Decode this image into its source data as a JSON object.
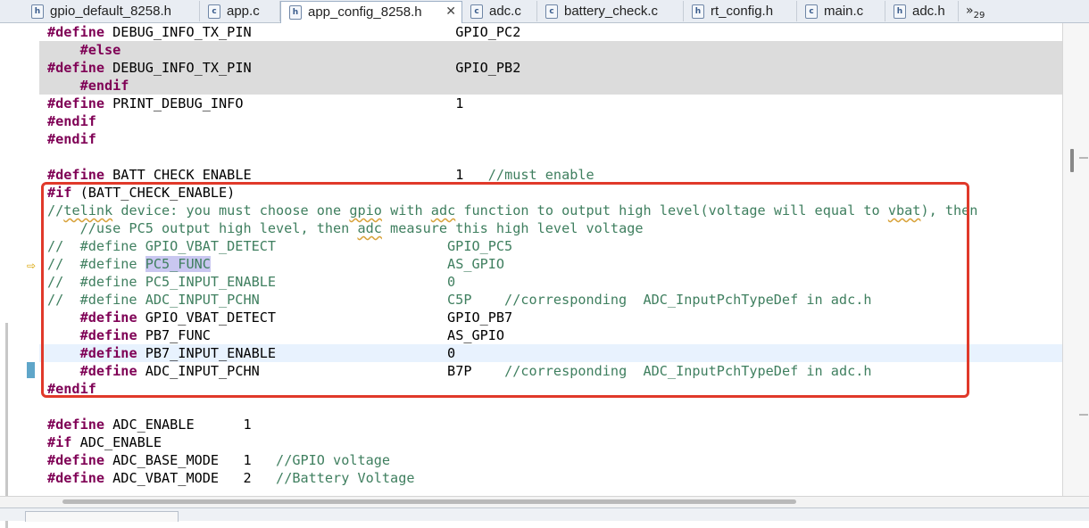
{
  "tabs": [
    {
      "label": "gpio_default_8258.h",
      "type": "h"
    },
    {
      "label": "app.c",
      "type": "c"
    },
    {
      "label": "app_config_8258.h",
      "type": "h",
      "active": true,
      "close": "✕"
    },
    {
      "label": "adc.c",
      "type": "c"
    },
    {
      "label": "battery_check.c",
      "type": "c"
    },
    {
      "label": "rt_config.h",
      "type": "h"
    },
    {
      "label": "main.c",
      "type": "c"
    },
    {
      "label": "adc.h",
      "type": "h"
    }
  ],
  "overflow": {
    "symbol": "»",
    "count": "29"
  },
  "code_lines": [
    {
      "segs": [
        [
          "kw",
          "#define"
        ],
        [
          "t",
          " DEBUG_INFO_TX_PIN                         GPIO_PC2"
        ]
      ]
    },
    {
      "shade": true,
      "segs": [
        [
          "t",
          "    "
        ],
        [
          "kw",
          "#else"
        ]
      ]
    },
    {
      "shade": true,
      "segs": [
        [
          "kw",
          "#define"
        ],
        [
          "t",
          " DEBUG_INFO_TX_PIN                         GPIO_PB2"
        ]
      ]
    },
    {
      "shade": true,
      "segs": [
        [
          "t",
          "    "
        ],
        [
          "kw",
          "#endif"
        ]
      ]
    },
    {
      "segs": [
        [
          "kw",
          "#define"
        ],
        [
          "t",
          " PRINT_DEBUG_INFO                          1"
        ]
      ]
    },
    {
      "segs": [
        [
          "kw",
          "#endif"
        ]
      ]
    },
    {
      "segs": [
        [
          "kw",
          "#endif"
        ]
      ]
    },
    {
      "segs": []
    },
    {
      "segs": [
        [
          "kw",
          "#define"
        ],
        [
          "t",
          " BATT_CHECK_ENABLE                         1   "
        ],
        [
          "cm",
          "//must enable"
        ]
      ]
    },
    {
      "segs": [
        [
          "kw",
          "#if"
        ],
        [
          "t",
          " (BATT_CHECK_ENABLE)"
        ]
      ]
    },
    {
      "segs": [
        [
          "cm",
          "//"
        ],
        [
          "cmsq",
          "telink"
        ],
        [
          "cm",
          " device: you must choose one "
        ],
        [
          "cmsq",
          "gpio"
        ],
        [
          "cm",
          " with "
        ],
        [
          "cmsq",
          "adc"
        ],
        [
          "cm",
          " function to output high level(voltage will equal to "
        ],
        [
          "cmsq",
          "vbat"
        ],
        [
          "cm",
          "), then"
        ]
      ]
    },
    {
      "segs": [
        [
          "cm",
          "    //use PC5 output high level, then "
        ],
        [
          "cmsq",
          "adc"
        ],
        [
          "cm",
          " measure this high level voltage"
        ]
      ]
    },
    {
      "segs": [
        [
          "cm",
          "//  #define GPIO_VBAT_DETECT                     GPIO_PC5"
        ]
      ]
    },
    {
      "segs": [
        [
          "cm",
          "//  #define "
        ],
        [
          "cmhl",
          "PC5_FUNC"
        ],
        [
          "cm",
          "                             AS_GPIO"
        ]
      ]
    },
    {
      "segs": [
        [
          "cm",
          "//  #define PC5_INPUT_ENABLE                     0"
        ]
      ]
    },
    {
      "segs": [
        [
          "cm",
          "//  #define ADC_INPUT_PCHN                       C5P    //corresponding  ADC_InputPchTypeDef in adc.h"
        ]
      ]
    },
    {
      "segs": [
        [
          "t",
          "    "
        ],
        [
          "kw",
          "#define"
        ],
        [
          "t",
          " GPIO_VBAT_DETECT                     GPIO_PB7"
        ]
      ]
    },
    {
      "segs": [
        [
          "t",
          "    "
        ],
        [
          "kw",
          "#define"
        ],
        [
          "t",
          " PB7_FUNC                             AS_GPIO"
        ]
      ]
    },
    {
      "cur": true,
      "segs": [
        [
          "t",
          "    "
        ],
        [
          "kw",
          "#define"
        ],
        [
          "t",
          " PB7_INPUT_ENABLE                     0"
        ]
      ]
    },
    {
      "segs": [
        [
          "t",
          "    "
        ],
        [
          "kw",
          "#define"
        ],
        [
          "t",
          " ADC_INPUT_PCHN                       B7P    "
        ],
        [
          "cm",
          "//corresponding  ADC_InputPchTypeDef in adc.h"
        ]
      ]
    },
    {
      "segs": [
        [
          "kw",
          "#endif"
        ]
      ]
    },
    {
      "segs": []
    },
    {
      "segs": [
        [
          "kw",
          "#define"
        ],
        [
          "t",
          " ADC_ENABLE      1"
        ]
      ]
    },
    {
      "segs": [
        [
          "kw",
          "#if"
        ],
        [
          "t",
          " ADC_ENABLE"
        ]
      ]
    },
    {
      "segs": [
        [
          "kw",
          "#define"
        ],
        [
          "t",
          " ADC_BASE_MODE   1   "
        ],
        [
          "cm",
          "//GPIO voltage"
        ]
      ]
    },
    {
      "segs": [
        [
          "kw",
          "#define"
        ],
        [
          "t",
          " ADC_VBAT_MODE   2   "
        ],
        [
          "cm",
          "//Battery Voltage"
        ]
      ]
    }
  ]
}
